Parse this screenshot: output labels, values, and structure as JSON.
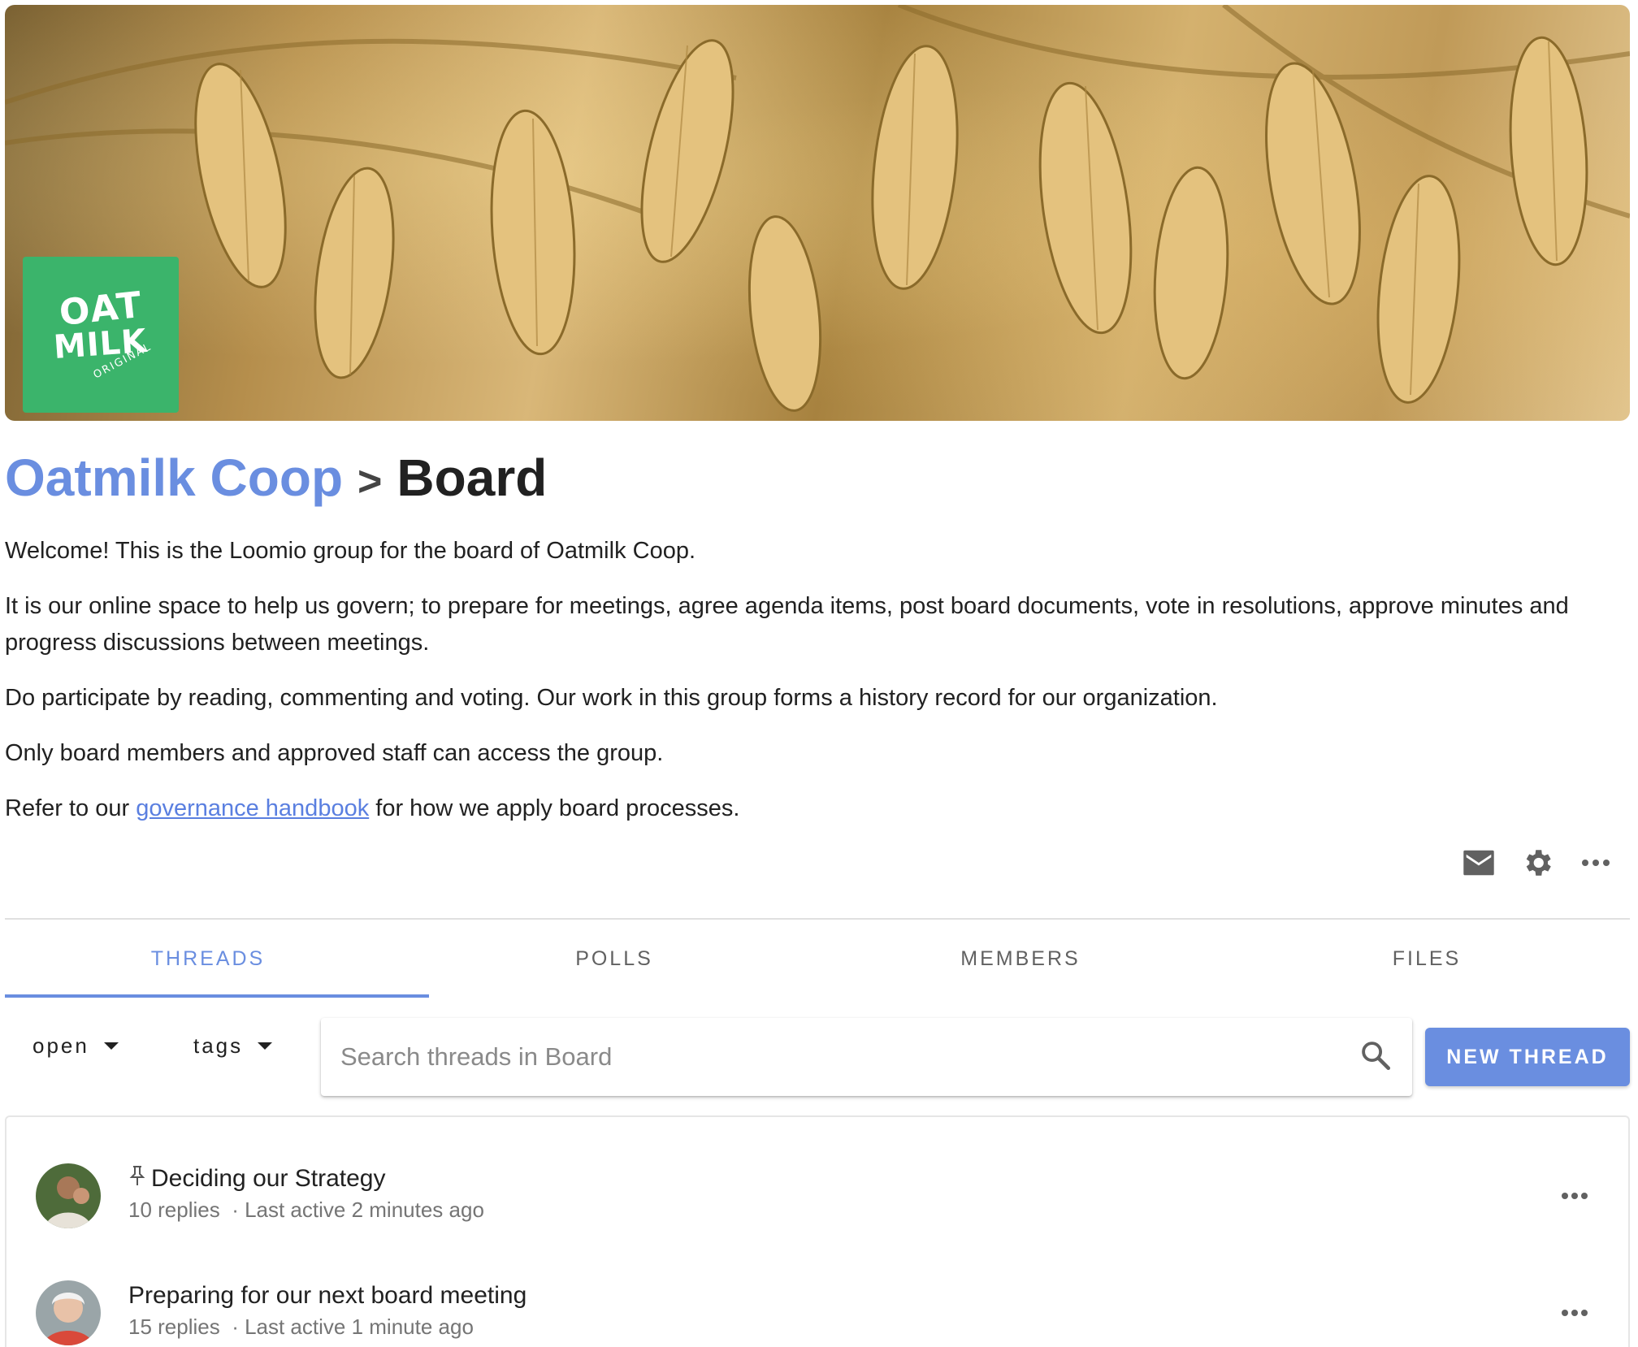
{
  "group": {
    "parent_name": "Oatmilk Coop",
    "separator": ">",
    "name": "Board",
    "logo": {
      "line1": "OAT",
      "line2": "MILK",
      "line3": "ORIGINAL",
      "color": "#3bb46b"
    }
  },
  "description": {
    "p1": "Welcome! This is the Loomio group for the board of Oatmilk Coop.",
    "p2": "It is our online space to help us govern; to prepare for meetings, agree agenda items, post board documents, vote in resolutions, approve minutes and progress discussions between meetings.",
    "p3": "Do participate by reading, commenting and voting. Our work in this group forms a history record for our organization.",
    "p4": "Only board members and approved staff can access the group.",
    "p5_before": "Refer to our ",
    "p5_link": "governance handbook",
    "p5_after": " for how we apply board processes."
  },
  "actions": {
    "icons": [
      "mail-icon",
      "gear-icon",
      "more-horizontal-icon"
    ]
  },
  "tabs": [
    {
      "label": "THREADS",
      "active": true
    },
    {
      "label": "POLLS",
      "active": false
    },
    {
      "label": "MEMBERS",
      "active": false
    },
    {
      "label": "FILES",
      "active": false
    }
  ],
  "filters": {
    "status": "open",
    "tags": "tags"
  },
  "search": {
    "placeholder": "Search threads in Board"
  },
  "new_thread_label": "NEW THREAD",
  "threads": [
    {
      "title": "Deciding our Strategy",
      "pinned": true,
      "replies": "10 replies",
      "last_active": "· Last active 2 minutes ago"
    },
    {
      "title": "Preparing for our next board meeting",
      "pinned": false,
      "replies": "15 replies",
      "last_active": "· Last active 1 minute ago"
    }
  ],
  "colors": {
    "accent": "#6a8ee0",
    "link": "#5a7fe0",
    "text": "#212121",
    "muted": "#757575"
  }
}
